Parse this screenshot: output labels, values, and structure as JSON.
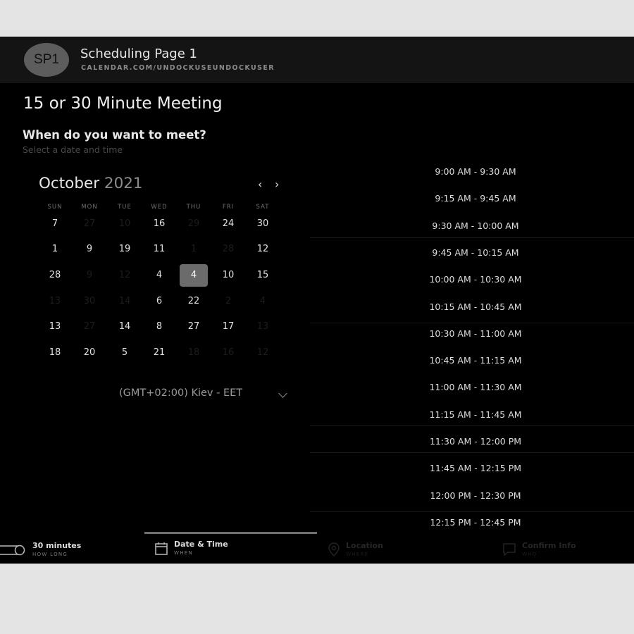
{
  "header": {
    "avatar_initials": "SP1",
    "page_name": "Scheduling Page 1",
    "page_url": "CALENDAR.COM/UNDOCKUSEUNDOCKUSER"
  },
  "meeting": {
    "title": "15 or 30 Minute Meeting",
    "question": "When do you want to meet?",
    "instruction": "Select a date and time"
  },
  "calendar": {
    "month": "October",
    "year": "2021",
    "prev_glyph": "‹",
    "next_glyph": "›",
    "weekdays": [
      "SUN",
      "MON",
      "TUE",
      "WED",
      "THU",
      "FRI",
      "SAT"
    ],
    "weeks": [
      [
        "7",
        "27",
        "10",
        "16",
        "29",
        "24",
        "30"
      ],
      [
        "1",
        "9",
        "19",
        "11",
        "1",
        "28",
        "12"
      ],
      [
        "28",
        "9",
        "12",
        "4",
        "4",
        "10",
        "15"
      ],
      [
        "13",
        "30",
        "14",
        "6",
        "22",
        "2",
        "4"
      ],
      [
        "13",
        "27",
        "14",
        "8",
        "27",
        "17",
        "13"
      ],
      [
        "18",
        "20",
        "5",
        "21",
        "18",
        "16",
        "12"
      ]
    ],
    "disabled": [
      [
        false,
        true,
        true,
        false,
        true,
        false,
        false
      ],
      [
        false,
        false,
        false,
        false,
        true,
        true,
        false
      ],
      [
        false,
        true,
        true,
        false,
        false,
        false,
        false
      ],
      [
        true,
        true,
        true,
        false,
        false,
        true,
        true
      ],
      [
        false,
        true,
        false,
        false,
        false,
        false,
        true
      ],
      [
        false,
        false,
        false,
        false,
        true,
        true,
        true
      ]
    ],
    "selected_day": "4",
    "timezone": "(GMT+02:00) Kiev - EET"
  },
  "time_slots": [
    "9:00 AM - 9:30 AM",
    "9:15 AM - 9:45 AM",
    "9:30 AM - 10:00 AM",
    "9:45 AM - 10:15 AM",
    "10:00 AM - 10:30 AM",
    "10:15 AM - 10:45 AM",
    "10:30 AM - 11:00 AM",
    "10:45 AM - 11:15 AM",
    "11:00 AM - 11:30 AM",
    "11:15 AM - 11:45 AM",
    "11:30 AM - 12:00 PM",
    "11:45 AM - 12:15 PM",
    "12:00 PM - 12:30 PM",
    "12:15 PM - 12:45 PM"
  ],
  "steps": [
    {
      "label": "30 minutes",
      "sub": "HOW LONG",
      "icon": "toggle-icon",
      "active": true
    },
    {
      "label": "Date & Time",
      "sub": "WHEN",
      "icon": "calendar-icon",
      "active": true
    },
    {
      "label": "Location",
      "sub": "WHERE",
      "icon": "location-pin-icon",
      "active": false
    },
    {
      "label": "Confirm Info",
      "sub": "WHO",
      "icon": "message-icon",
      "active": false
    }
  ]
}
